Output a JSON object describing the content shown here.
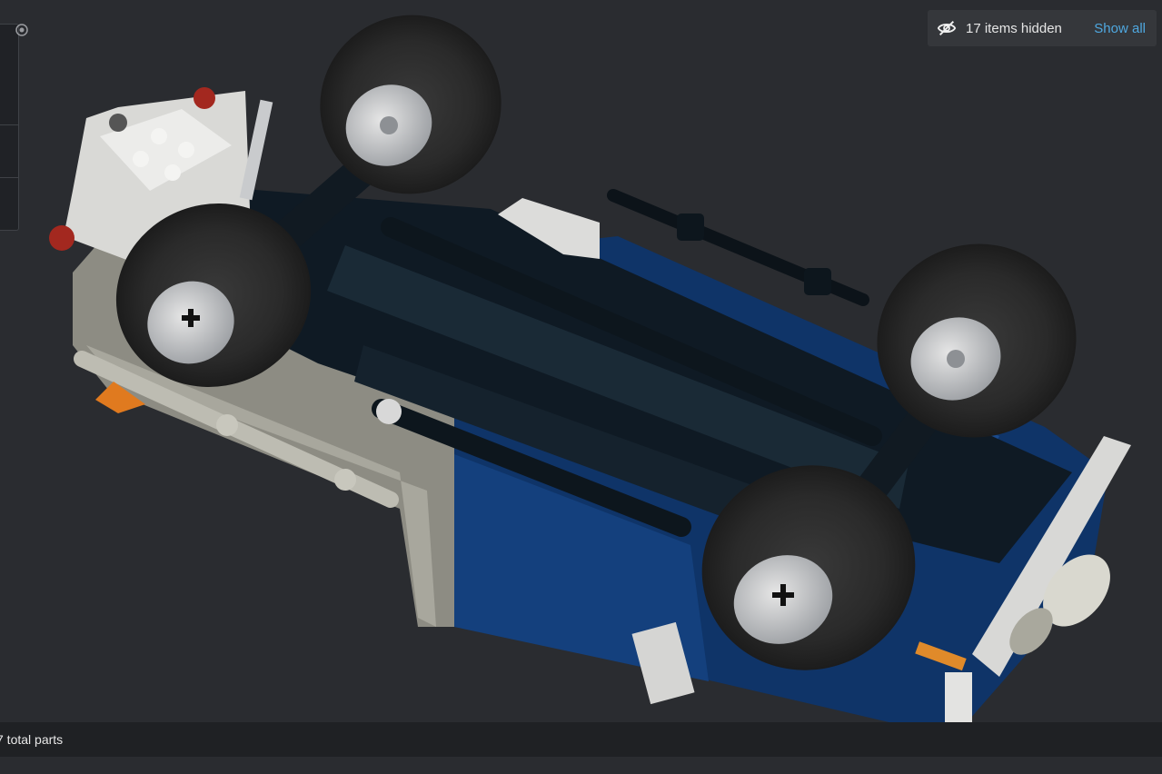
{
  "hidden_bar": {
    "count_text": "17 items hidden",
    "show_all_label": "Show all"
  },
  "status": {
    "parts_text": "7 total parts"
  },
  "icons": {
    "hidden": "eye-off-icon",
    "target": "target-icon"
  },
  "colors": {
    "background": "#2a2c30",
    "accent": "#4fa8e0",
    "panel": "#35373b"
  }
}
